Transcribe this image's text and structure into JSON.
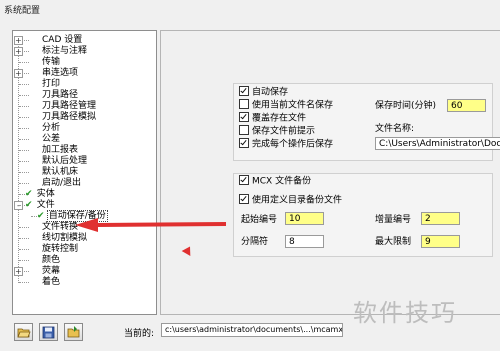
{
  "window": {
    "title": "系统配置"
  },
  "tree": {
    "items": [
      {
        "label": "CAD 设置",
        "expander": "+",
        "check": false
      },
      {
        "label": "标注与注释",
        "expander": "+",
        "check": false
      },
      {
        "label": "传输",
        "expander": "",
        "check": false
      },
      {
        "label": "串连选项",
        "expander": "+",
        "check": false
      },
      {
        "label": "打印",
        "expander": "",
        "check": false
      },
      {
        "label": "刀具路径",
        "expander": "",
        "check": false
      },
      {
        "label": "刀具路径管理",
        "expander": "",
        "check": false
      },
      {
        "label": "刀具路径模拟",
        "expander": "",
        "check": false
      },
      {
        "label": "分析",
        "expander": "",
        "check": false
      },
      {
        "label": "公差",
        "expander": "",
        "check": false
      },
      {
        "label": "加工报表",
        "expander": "",
        "check": false
      },
      {
        "label": "默认后处理",
        "expander": "",
        "check": false
      },
      {
        "label": "默认机床",
        "expander": "",
        "check": false
      },
      {
        "label": "启动/退出",
        "expander": "",
        "check": false
      },
      {
        "label": "实体",
        "expander": "",
        "check": true
      },
      {
        "label": "文件",
        "expander": "-",
        "check": true
      },
      {
        "label": "自动保存/备份",
        "expander": "",
        "check": true,
        "child": true,
        "selected": true
      },
      {
        "label": "文件转换",
        "expander": "",
        "check": false
      },
      {
        "label": "线切割模拟",
        "expander": "",
        "check": false
      },
      {
        "label": "旋转控制",
        "expander": "",
        "check": false
      },
      {
        "label": "颜色",
        "expander": "",
        "check": false
      },
      {
        "label": "荧幕",
        "expander": "+",
        "check": false
      },
      {
        "label": "着色",
        "expander": "",
        "check": false
      }
    ]
  },
  "autosave": {
    "enable_label": "自动保存",
    "use_current_name_label": "使用当前文件名保存",
    "overwrite_label": "覆盖存在文件",
    "prompt_label": "保存文件前提示",
    "after_each_label": "完成每个操作后保存",
    "interval_label": "保存时间(分钟)",
    "interval_value": "60",
    "filename_label": "文件名称:",
    "filename_value": "C:\\Users\\Administrator\\Documents\\my"
  },
  "backup": {
    "enable_label": "MCX 文件备份",
    "custom_dir_label": "使用定义目录备份文件",
    "start_num_label": "起始编号",
    "start_num_value": "10",
    "increment_label": "增量编号",
    "increment_value": "2",
    "separator_label": "分隔符",
    "separator_value": "8",
    "max_label": "最大限制",
    "max_value": "9"
  },
  "footer": {
    "current_label": "当前的:",
    "current_value": "c:\\users\\administrator\\documents\\...\\mcamxm.config <公制"
  },
  "watermark": "软件技巧",
  "colors": {
    "check_green": "#2a9a2a",
    "highlight_yellow": "#ffff88",
    "arrow_red": "#e03030"
  }
}
